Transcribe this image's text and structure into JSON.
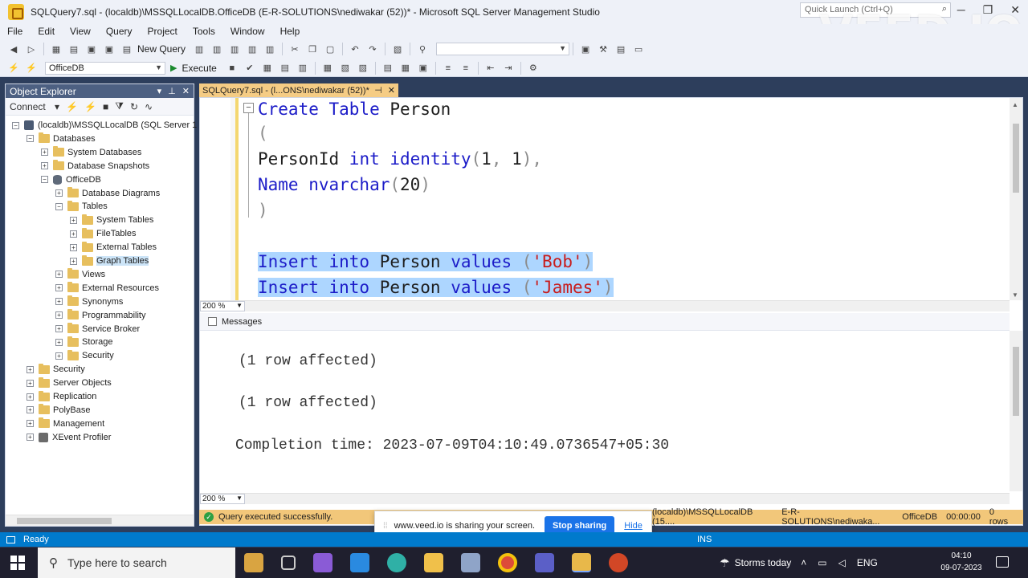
{
  "window": {
    "title": "SQLQuery7.sql - (localdb)\\MSSQLLocalDB.OfficeDB (E-R-SOLUTIONS\\nediwakar (52))* - Microsoft SQL Server Management Studio",
    "quick_launch_placeholder": "Quick Launch (Ctrl+Q)",
    "watermark": "VEED.IO"
  },
  "menu": [
    "File",
    "Edit",
    "View",
    "Query",
    "Project",
    "Tools",
    "Window",
    "Help"
  ],
  "toolbar": {
    "new_query": "New Query",
    "database": "OfficeDB",
    "execute": "Execute"
  },
  "object_explorer": {
    "title": "Object Explorer",
    "connect": "Connect",
    "tree": [
      {
        "label": "(localdb)\\MSSQLLocalDB (SQL Server 1",
        "level": 0,
        "expanded": true,
        "icon": "server-icon"
      },
      {
        "label": "Databases",
        "level": 1,
        "expanded": true,
        "icon": "folder-icon"
      },
      {
        "label": "System Databases",
        "level": 2,
        "expanded": false,
        "icon": "folder-icon"
      },
      {
        "label": "Database Snapshots",
        "level": 2,
        "expanded": false,
        "icon": "folder-icon"
      },
      {
        "label": "OfficeDB",
        "level": 2,
        "expanded": true,
        "icon": "database-icon"
      },
      {
        "label": "Database Diagrams",
        "level": 3,
        "expanded": false,
        "icon": "folder-icon"
      },
      {
        "label": "Tables",
        "level": 3,
        "expanded": true,
        "icon": "folder-icon"
      },
      {
        "label": "System Tables",
        "level": 4,
        "expanded": false,
        "icon": "folder-icon"
      },
      {
        "label": "FileTables",
        "level": 4,
        "expanded": false,
        "icon": "folder-icon"
      },
      {
        "label": "External Tables",
        "level": 4,
        "expanded": false,
        "icon": "folder-icon"
      },
      {
        "label": "Graph Tables",
        "level": 4,
        "expanded": false,
        "icon": "folder-icon",
        "selected": true
      },
      {
        "label": "Views",
        "level": 3,
        "expanded": false,
        "icon": "folder-icon"
      },
      {
        "label": "External Resources",
        "level": 3,
        "expanded": false,
        "icon": "folder-icon"
      },
      {
        "label": "Synonyms",
        "level": 3,
        "expanded": false,
        "icon": "folder-icon"
      },
      {
        "label": "Programmability",
        "level": 3,
        "expanded": false,
        "icon": "folder-icon"
      },
      {
        "label": "Service Broker",
        "level": 3,
        "expanded": false,
        "icon": "folder-icon"
      },
      {
        "label": "Storage",
        "level": 3,
        "expanded": false,
        "icon": "folder-icon"
      },
      {
        "label": "Security",
        "level": 3,
        "expanded": false,
        "icon": "folder-icon"
      },
      {
        "label": "Security",
        "level": 1,
        "expanded": false,
        "icon": "folder-icon"
      },
      {
        "label": "Server Objects",
        "level": 1,
        "expanded": false,
        "icon": "folder-icon"
      },
      {
        "label": "Replication",
        "level": 1,
        "expanded": false,
        "icon": "folder-icon"
      },
      {
        "label": "PolyBase",
        "level": 1,
        "expanded": false,
        "icon": "folder-icon"
      },
      {
        "label": "Management",
        "level": 1,
        "expanded": false,
        "icon": "folder-icon"
      },
      {
        "label": "XEvent Profiler",
        "level": 1,
        "expanded": false,
        "icon": "profiler-icon"
      }
    ]
  },
  "editor": {
    "tab_label": "SQLQuery7.sql - (l...ONS\\nediwakar (52))*",
    "zoom": "200 %",
    "lines": [
      [
        {
          "t": "Create Table ",
          "c": "kw"
        },
        {
          "t": "Person",
          "c": "pl"
        }
      ],
      [
        {
          "t": "(",
          "c": "gr"
        }
      ],
      [
        {
          "t": "PersonId ",
          "c": "pl"
        },
        {
          "t": "int identity",
          "c": "kw"
        },
        {
          "t": "(",
          "c": "gr"
        },
        {
          "t": "1",
          "c": "pl"
        },
        {
          "t": ", ",
          "c": "gr"
        },
        {
          "t": "1",
          "c": "pl"
        },
        {
          "t": "),",
          "c": "gr"
        }
      ],
      [
        {
          "t": "Name ",
          "c": "kw"
        },
        {
          "t": "nvarchar",
          "c": "kw"
        },
        {
          "t": "(",
          "c": "gr"
        },
        {
          "t": "20",
          "c": "pl"
        },
        {
          "t": ")",
          "c": "gr"
        }
      ],
      [
        {
          "t": ")",
          "c": "gr"
        }
      ],
      [],
      [
        {
          "t": "Insert into ",
          "c": "kw"
        },
        {
          "t": "Person ",
          "c": "pl"
        },
        {
          "t": "values ",
          "c": "kw"
        },
        {
          "t": "(",
          "c": "gr"
        },
        {
          "t": "'Bob'",
          "c": "str"
        },
        {
          "t": ")",
          "c": "gr"
        }
      ],
      [
        {
          "t": "Insert into ",
          "c": "kw"
        },
        {
          "t": "Person ",
          "c": "pl"
        },
        {
          "t": "values ",
          "c": "kw"
        },
        {
          "t": "(",
          "c": "gr"
        },
        {
          "t": "'James'",
          "c": "str"
        },
        {
          "t": ")",
          "c": "gr"
        }
      ]
    ],
    "highlighted_lines": [
      6,
      7
    ]
  },
  "results": {
    "tab_label": "Messages",
    "zoom": "200 %",
    "lines": [
      "(1 row affected)",
      "(1 row affected)",
      "Completion time: 2023-07-09T04:10:49.0736547+05:30"
    ]
  },
  "query_status": {
    "message": "Query executed successfully.",
    "server": "(localdb)\\MSSQLLocalDB (15....",
    "user": "E-R-SOLUTIONS\\nediwaka...",
    "database": "OfficeDB",
    "elapsed": "00:00:00",
    "rows": "0 rows"
  },
  "share_banner": {
    "text": "www.veed.io is sharing your screen.",
    "stop": "Stop sharing",
    "hide": "Hide"
  },
  "statusbar": {
    "ready": "Ready",
    "mode": "INS"
  },
  "taskbar": {
    "search_placeholder": "Type here to search",
    "weather": "Storms today",
    "language": "ENG",
    "time": "04:10",
    "date": "09-07-2023"
  },
  "colors": {
    "accent_blue": "#007acc",
    "status_orange": "#f2c77a",
    "tab_orange": "#f5cc84",
    "keyword": "#1c1cc8",
    "string": "#c81c1c",
    "selection": "#add6ff"
  }
}
